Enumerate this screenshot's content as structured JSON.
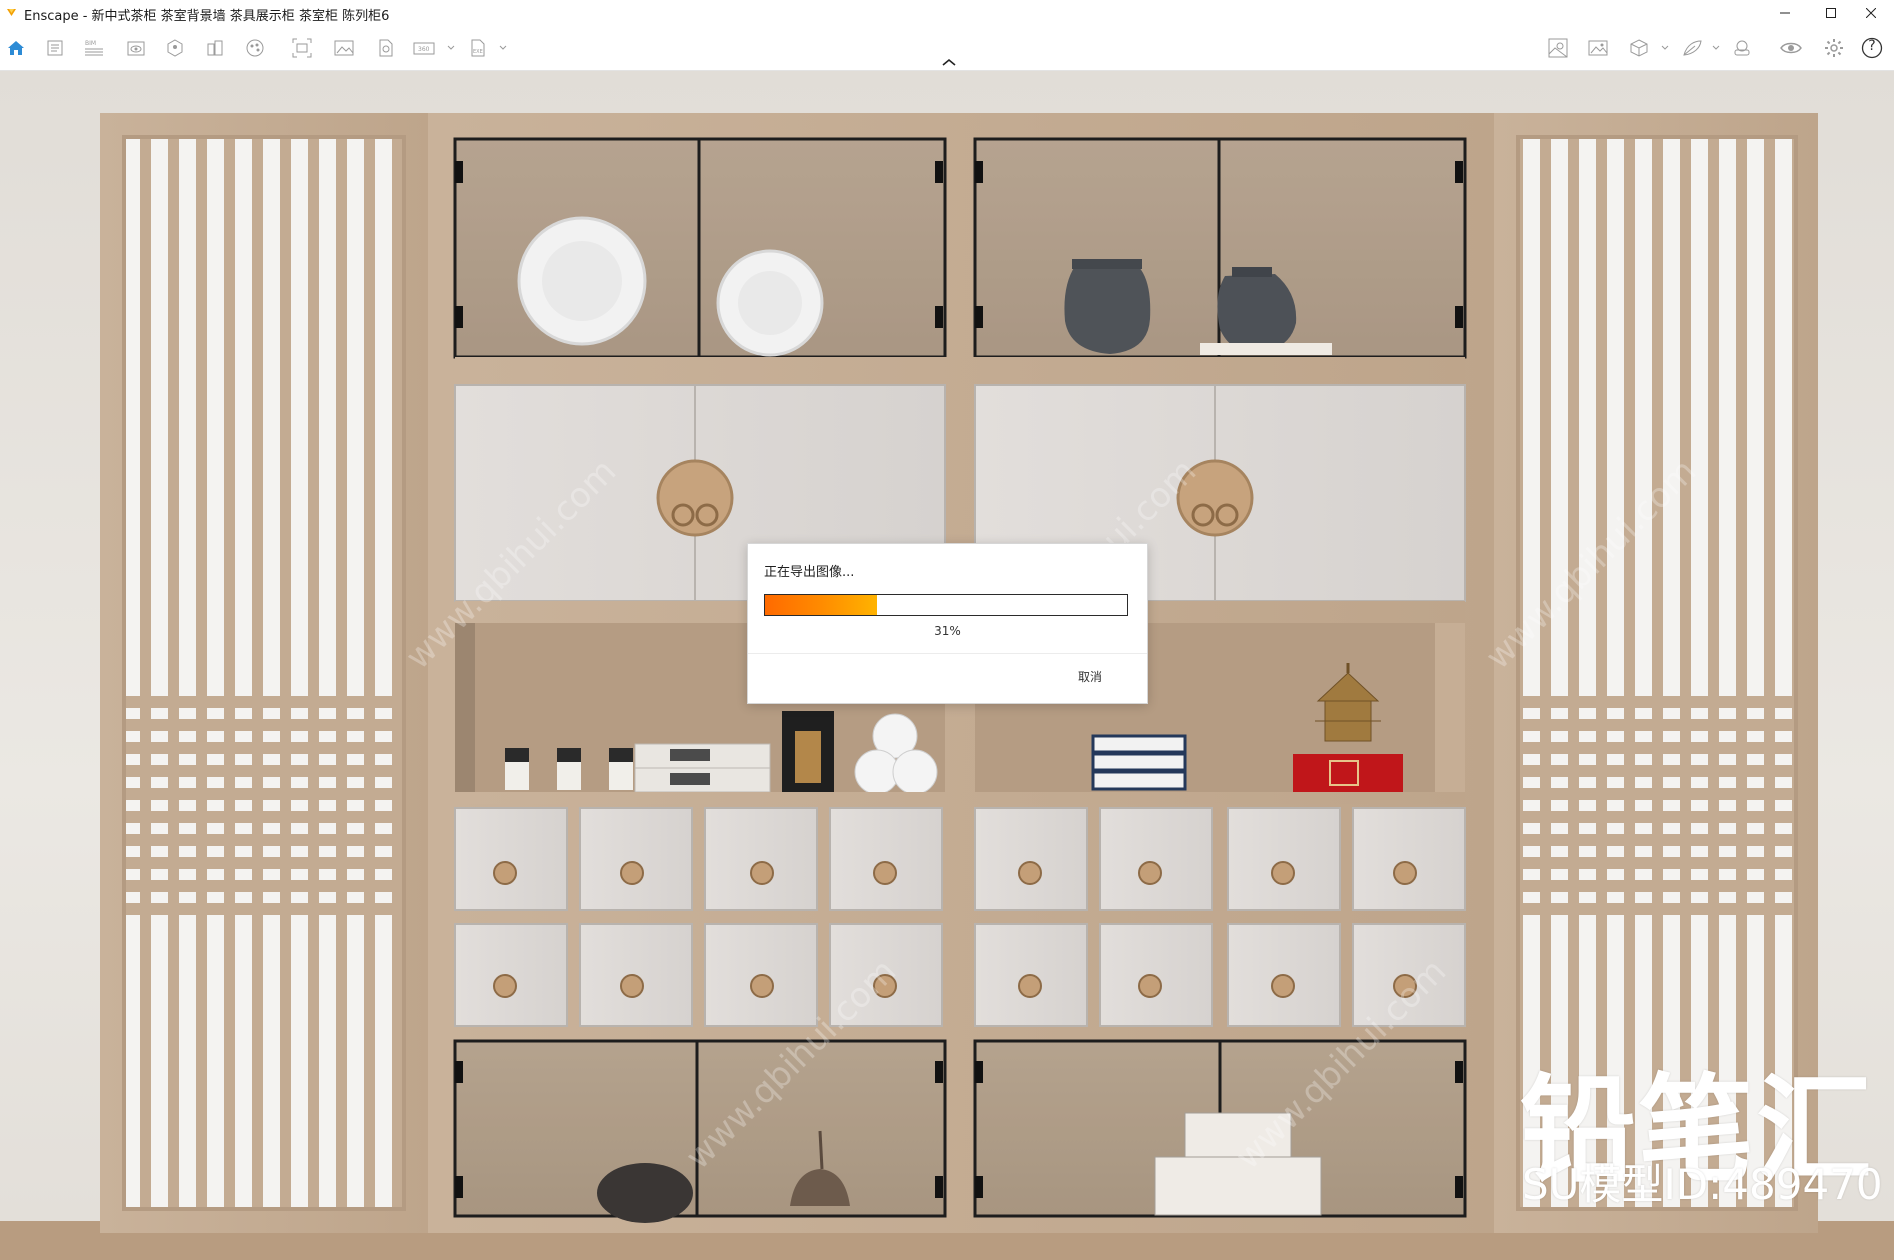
{
  "window": {
    "title": "Enscape - 新中式茶柜 茶室背景墙 茶具展示柜 茶室柜 陈列柜6",
    "controls": [
      "minimize",
      "maximize",
      "close"
    ]
  },
  "toolbar": {
    "left_icons": [
      "home-icon",
      "project-info-icon",
      "bim-icon",
      "visual-settings-icon",
      "views-icon",
      "buildings-icon",
      "material-editor-icon",
      "capture-icon",
      "screenshot-icon",
      "batch-render-icon",
      "panorama-icon",
      "exe-export-icon"
    ],
    "right_icons": [
      "site-context-icon",
      "image-gallery-icon",
      "asset-library-icon",
      "material-icon",
      "vr-icon",
      "visibility-icon",
      "settings-icon",
      "help-icon"
    ],
    "help_label": "?",
    "accent_color": "#2d8bd5"
  },
  "watermark": {
    "brand": "铅笔汇",
    "model_id": "SU模型ID:489470"
  },
  "export_dialog": {
    "title": "正在导出图像...",
    "progress_percent": 31,
    "progress_label": "31%",
    "cancel_label": "取消"
  }
}
